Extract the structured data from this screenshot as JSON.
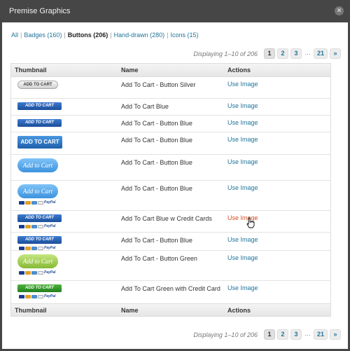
{
  "window": {
    "title": "Premise Graphics"
  },
  "filters": [
    {
      "label": "All",
      "count": "",
      "current": false
    },
    {
      "label": "Badges (160)",
      "current": false
    },
    {
      "label": "Buttons (206)",
      "current": true
    },
    {
      "label": "Hand-drawn (280)",
      "current": false
    },
    {
      "label": "Icons (15)",
      "current": false
    }
  ],
  "pager": {
    "displaying": "Displaying 1–10 of 206",
    "pages": [
      "1",
      "2",
      "3",
      "…",
      "21",
      "»"
    ],
    "current_page": "1"
  },
  "table": {
    "columns": [
      "Thumbnail",
      "Name",
      "Actions"
    ],
    "action_label": "Use Image",
    "rows": [
      {
        "name": "Add To Cart - Button Silver",
        "thumb_text": "ADD TO CART",
        "style": "silver",
        "cards": false
      },
      {
        "name": "Add To Cart Blue",
        "thumb_text": "ADD TO CART",
        "style": "blue-sm",
        "cards": false
      },
      {
        "name": "Add To Cart - Button Blue",
        "thumb_text": "ADD TO CART",
        "style": "blue-sm",
        "cards": false
      },
      {
        "name": "Add To Cart - Button Blue",
        "thumb_text": "ADD TO CART",
        "style": "blue-md",
        "cards": false
      },
      {
        "name": "Add To Cart - Button Blue",
        "thumb_text": "Add to Cart",
        "style": "blue-oval",
        "cards": false
      },
      {
        "name": "Add To Cart - Button Blue",
        "thumb_text": "Add to Cart",
        "style": "blue-oval",
        "cards": true
      },
      {
        "name": "Add To Cart Blue w Credit Cards",
        "thumb_text": "ADD TO CART",
        "style": "blue-sm",
        "cards": true,
        "hover": true
      },
      {
        "name": "Add To Cart - Button Blue",
        "thumb_text": "ADD TO CART",
        "style": "blue-sm",
        "cards": true
      },
      {
        "name": "Add To Cart - Button Green",
        "thumb_text": "Add to Cart",
        "style": "green-oval",
        "cards": true
      },
      {
        "name": "Add To Cart Green with Credit Card",
        "thumb_text": "ADD TO CART",
        "style": "green-sm",
        "cards": true
      }
    ]
  },
  "colors": {
    "link": "#21759b",
    "link_hover": "#d54e21",
    "chrome": "#464646"
  }
}
